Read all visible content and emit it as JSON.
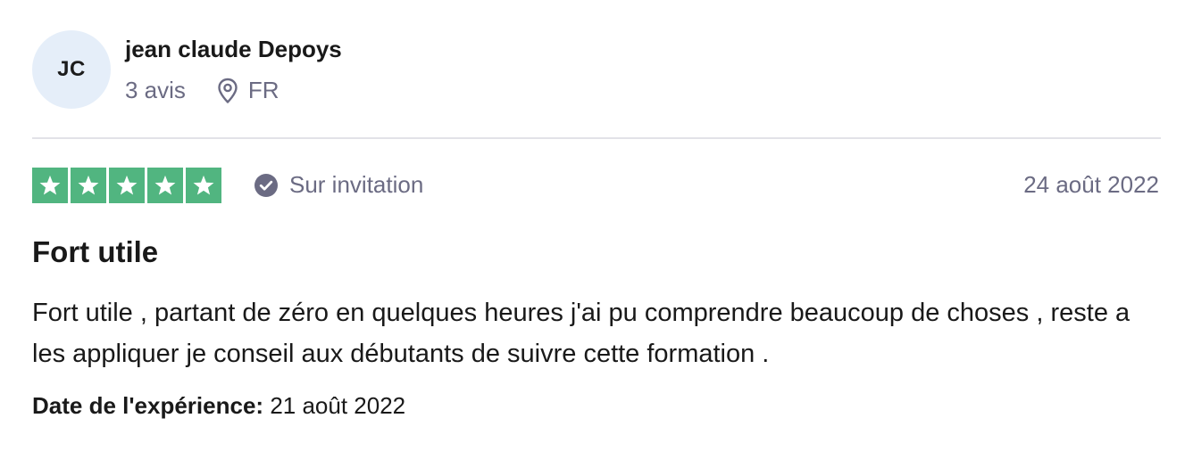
{
  "reviewer": {
    "initials": "JC",
    "name": "jean claude Depoys",
    "review_count": "3 avis",
    "country": "FR"
  },
  "review": {
    "rating": 5,
    "rating_color": "#51b580",
    "verification": "Sur invitation",
    "date": "24 août 2022",
    "title": "Fort utile",
    "body": "Fort utile , partant de zéro en quelques heures j'ai pu comprendre beaucoup de choses , reste a les appliquer je conseil aux débutants de suivre cette formation .",
    "experience_label": "Date de l'expérience:",
    "experience_date": "21 août 2022"
  },
  "icons": {
    "location": "location-pin-icon",
    "verified": "check-circle-icon",
    "star": "star-icon"
  }
}
